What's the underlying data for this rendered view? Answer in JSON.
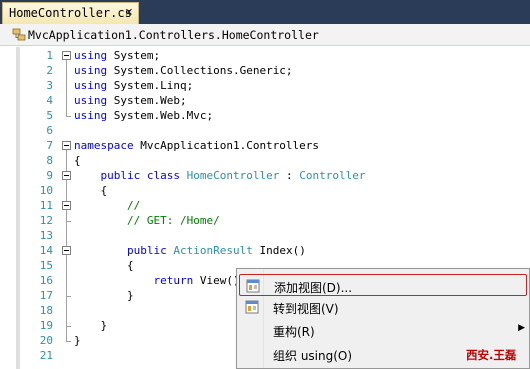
{
  "tab": {
    "title": "HomeController.cs",
    "close": "×"
  },
  "nav": {
    "breadcrumb": "MvcApplication1.Controllers.HomeController"
  },
  "editor": {
    "line_numbers": [
      "1",
      "2",
      "3",
      "4",
      "5",
      "6",
      "7",
      "8",
      "9",
      "10",
      "11",
      "12",
      "13",
      "14",
      "15",
      "16",
      "17",
      "18",
      "19",
      "20",
      "21"
    ],
    "lines": [
      [
        {
          "t": "using",
          "c": "kw"
        },
        {
          "t": " System;",
          "c": ""
        }
      ],
      [
        {
          "t": "using",
          "c": "kw"
        },
        {
          "t": " System.Collections.Generic;",
          "c": ""
        }
      ],
      [
        {
          "t": "using",
          "c": "kw"
        },
        {
          "t": " System.Linq;",
          "c": ""
        }
      ],
      [
        {
          "t": "using",
          "c": "kw"
        },
        {
          "t": " System.Web;",
          "c": ""
        }
      ],
      [
        {
          "t": "using",
          "c": "kw"
        },
        {
          "t": " System.Web.Mvc;",
          "c": ""
        }
      ],
      [],
      [
        {
          "t": "namespace",
          "c": "kw"
        },
        {
          "t": " MvcApplication1.Controllers",
          "c": ""
        }
      ],
      [
        {
          "t": "{",
          "c": ""
        }
      ],
      [
        {
          "t": "    ",
          "c": ""
        },
        {
          "t": "public",
          "c": "kw"
        },
        {
          "t": " ",
          "c": ""
        },
        {
          "t": "class",
          "c": "kw"
        },
        {
          "t": " ",
          "c": ""
        },
        {
          "t": "HomeController",
          "c": "typ"
        },
        {
          "t": " : ",
          "c": ""
        },
        {
          "t": "Controller",
          "c": "typ"
        }
      ],
      [
        {
          "t": "    {",
          "c": ""
        }
      ],
      [
        {
          "t": "        //",
          "c": "cmt"
        }
      ],
      [
        {
          "t": "        // GET: /Home/",
          "c": "cmt"
        }
      ],
      [],
      [
        {
          "t": "        ",
          "c": ""
        },
        {
          "t": "public",
          "c": "kw"
        },
        {
          "t": " ",
          "c": ""
        },
        {
          "t": "ActionResult",
          "c": "typ"
        },
        {
          "t": " Index()",
          "c": ""
        }
      ],
      [
        {
          "t": "        {",
          "c": ""
        }
      ],
      [
        {
          "t": "            ",
          "c": ""
        },
        {
          "t": "return",
          "c": "kw"
        },
        {
          "t": " View();",
          "c": ""
        }
      ],
      [
        {
          "t": "        }",
          "c": ""
        }
      ],
      [],
      [
        {
          "t": "    }",
          "c": ""
        }
      ],
      [
        {
          "t": "}",
          "c": ""
        }
      ],
      []
    ]
  },
  "context_menu": {
    "items": [
      {
        "label": "添加视图(D)...",
        "icon": "add-view-icon",
        "highlighted": true
      },
      {
        "label": "转到视图(V)",
        "icon": "go-to-view-icon"
      },
      {
        "label": "重构(R)",
        "submenu": true
      },
      {
        "label": "组织 using(O)",
        "submenu": false
      }
    ],
    "submenu_arrow": "▶"
  },
  "watermark": "西安.王磊",
  "colors": {
    "keyword": "#0000ff",
    "type": "#2b91af",
    "comment": "#008000",
    "line_number": "#2b91af",
    "highlight_border": "#d02020"
  }
}
